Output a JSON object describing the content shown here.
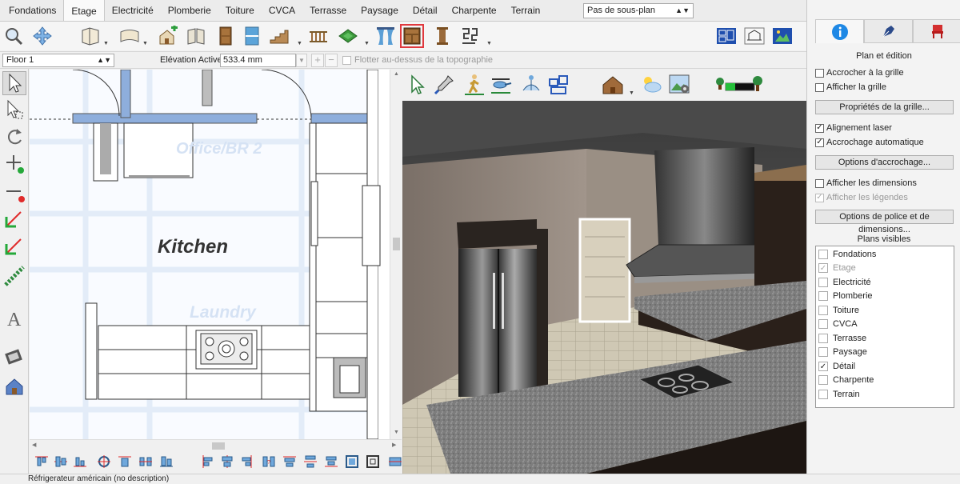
{
  "tabs": [
    {
      "label": "Fondations",
      "active": false
    },
    {
      "label": "Etage",
      "active": true
    },
    {
      "label": "Electricité",
      "active": false
    },
    {
      "label": "Plomberie",
      "active": false
    },
    {
      "label": "Toiture",
      "active": false
    },
    {
      "label": "CVCA",
      "active": false
    },
    {
      "label": "Terrasse",
      "active": false
    },
    {
      "label": "Paysage",
      "active": false
    },
    {
      "label": "Détail",
      "active": false
    },
    {
      "label": "Charpente",
      "active": false
    },
    {
      "label": "Terrain",
      "active": false
    }
  ],
  "subplan": {
    "value": "Pas de sous-plan"
  },
  "toolbar": {
    "icons": [
      "zoom-icon",
      "pan-icon",
      "wall-icon",
      "roof-icon",
      "add-room-icon",
      "floor-icon",
      "door-icon",
      "window-icon",
      "stairs-icon",
      "railing-icon",
      "terrain-icon",
      "curtain-icon",
      "cabinet-icon",
      "column-icon",
      "pattern-icon",
      "floorplan-view-icon",
      "elevation-view-icon",
      "3d-view-icon"
    ],
    "selected": "cabinet-icon"
  },
  "propbar": {
    "floor": "Floor 1",
    "elevation_label": "Elévation Active:",
    "elevation_value": "533.4 mm",
    "float_label": "Flotter au-dessus de la topographie"
  },
  "plan": {
    "rooms": {
      "kitchen": "Kitchen",
      "office": "Office/BR 2",
      "laundry": "Laundry"
    }
  },
  "right_panel": {
    "tabs": [
      "info-icon",
      "pen-icon",
      "chair-icon"
    ],
    "section_title": "Plan et édition",
    "snap_grid": {
      "label": "Accrocher à la grille",
      "checked": false
    },
    "show_grid": {
      "label": "Afficher la grille",
      "checked": false
    },
    "grid_props_btn": "Propriétés de la grille...",
    "laser_align": {
      "label": "Alignement laser",
      "checked": true
    },
    "auto_snap": {
      "label": "Accrochage automatique",
      "checked": true
    },
    "snap_options_btn": "Options d'accrochage...",
    "show_dims": {
      "label": "Afficher les dimensions",
      "checked": false
    },
    "show_legends": {
      "label": "Afficher les légendes",
      "checked": true
    },
    "font_dims_btn": "Options de police et de dimensions...",
    "visible_plans_title": "Plans visibles",
    "visible_plans": [
      {
        "label": "Fondations",
        "checked": false,
        "disabled": false
      },
      {
        "label": "Etage",
        "checked": true,
        "disabled": true
      },
      {
        "label": "Electricité",
        "checked": false,
        "disabled": false
      },
      {
        "label": "Plomberie",
        "checked": false,
        "disabled": false
      },
      {
        "label": "Toiture",
        "checked": false,
        "disabled": false
      },
      {
        "label": "CVCA",
        "checked": false,
        "disabled": false
      },
      {
        "label": "Terrasse",
        "checked": false,
        "disabled": false
      },
      {
        "label": "Paysage",
        "checked": false,
        "disabled": false
      },
      {
        "label": "Détail",
        "checked": true,
        "disabled": false
      },
      {
        "label": "Charpente",
        "checked": false,
        "disabled": false
      },
      {
        "label": "Terrain",
        "checked": false,
        "disabled": false
      }
    ]
  },
  "status": {
    "text": "Réfrigerateur américain (no description)"
  },
  "colors": {
    "accent": "#1e88e5",
    "selected_border": "#e0393e",
    "wall_blue": "#8eaedc"
  }
}
